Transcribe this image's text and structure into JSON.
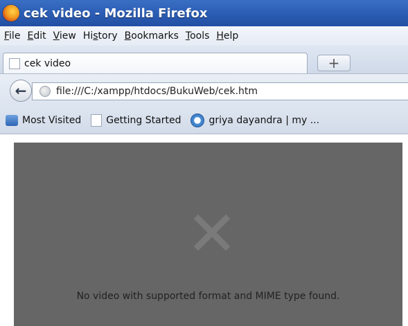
{
  "window": {
    "title": "cek video - Mozilla Firefox"
  },
  "menu": {
    "items": [
      {
        "accel": "F",
        "rest": "ile"
      },
      {
        "accel": "E",
        "rest": "dit"
      },
      {
        "accel": "V",
        "rest": "iew"
      },
      {
        "pre": "Hi",
        "accel": "s",
        "rest": "tory"
      },
      {
        "accel": "B",
        "rest": "ookmarks"
      },
      {
        "accel": "T",
        "rest": "ools"
      },
      {
        "accel": "H",
        "rest": "elp"
      }
    ]
  },
  "tabs": {
    "active_label": "cek video",
    "new_tab_symbol": "+"
  },
  "navigation": {
    "back_symbol": "←",
    "url": "file:///C:/xampp/htdocs/BukuWeb/cek.htm"
  },
  "bookmarks": {
    "items": [
      {
        "label": "Most Visited",
        "icon": "most-visited-icon"
      },
      {
        "label": "Getting Started",
        "icon": "page-icon"
      },
      {
        "label": "griya dayandra | my ...",
        "icon": "wordpress-icon"
      }
    ]
  },
  "video": {
    "error_message": "No video with supported format and MIME type found."
  }
}
